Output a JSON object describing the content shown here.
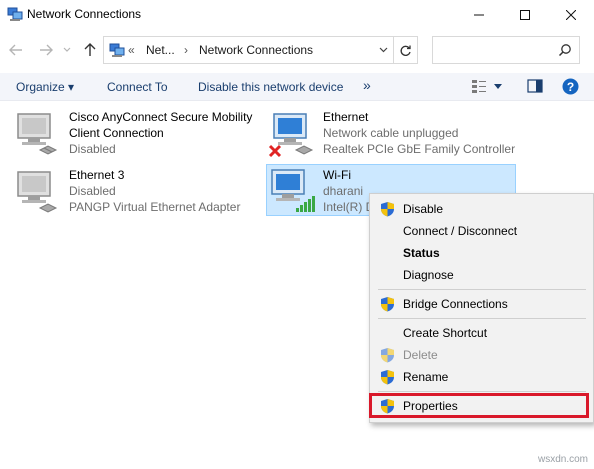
{
  "window": {
    "title": "Network Connections"
  },
  "address_bar": {
    "overflow": "«",
    "crumb_1": "Net...",
    "separator": "›",
    "crumb_2": "Network Connections"
  },
  "search": {
    "placeholder": ""
  },
  "command_bar": {
    "organize": "Organize ▾",
    "connect_to": "Connect To",
    "disable_device": "Disable this network device",
    "more": "»"
  },
  "connections": [
    {
      "name_line1": "Cisco AnyConnect Secure Mobility",
      "name_line2": "Client Connection",
      "status": "Disabled",
      "device": ""
    },
    {
      "name_line1": "Ethernet",
      "name_line2": "",
      "status": "Network cable unplugged",
      "device": "Realtek PCIe GbE Family Controller"
    },
    {
      "name_line1": "Ethernet 3",
      "name_line2": "",
      "status": "Disabled",
      "device": "PANGP Virtual Ethernet Adapter"
    },
    {
      "name_line1": "Wi-Fi",
      "name_line2": "",
      "status": "dharani",
      "device": "Intel(R) D"
    }
  ],
  "context_menu": {
    "disable": "Disable",
    "connect_disconnect": "Connect / Disconnect",
    "status": "Status",
    "diagnose": "Diagnose",
    "bridge": "Bridge Connections",
    "create_shortcut": "Create Shortcut",
    "delete": "Delete",
    "rename": "Rename",
    "properties": "Properties"
  },
  "watermark": "wsxdn.com",
  "colors": {
    "selection": "#cce8ff",
    "highlight": "#d9182a",
    "menu_bg": "#f2f2f2",
    "link_text": "#1a3e6e"
  }
}
